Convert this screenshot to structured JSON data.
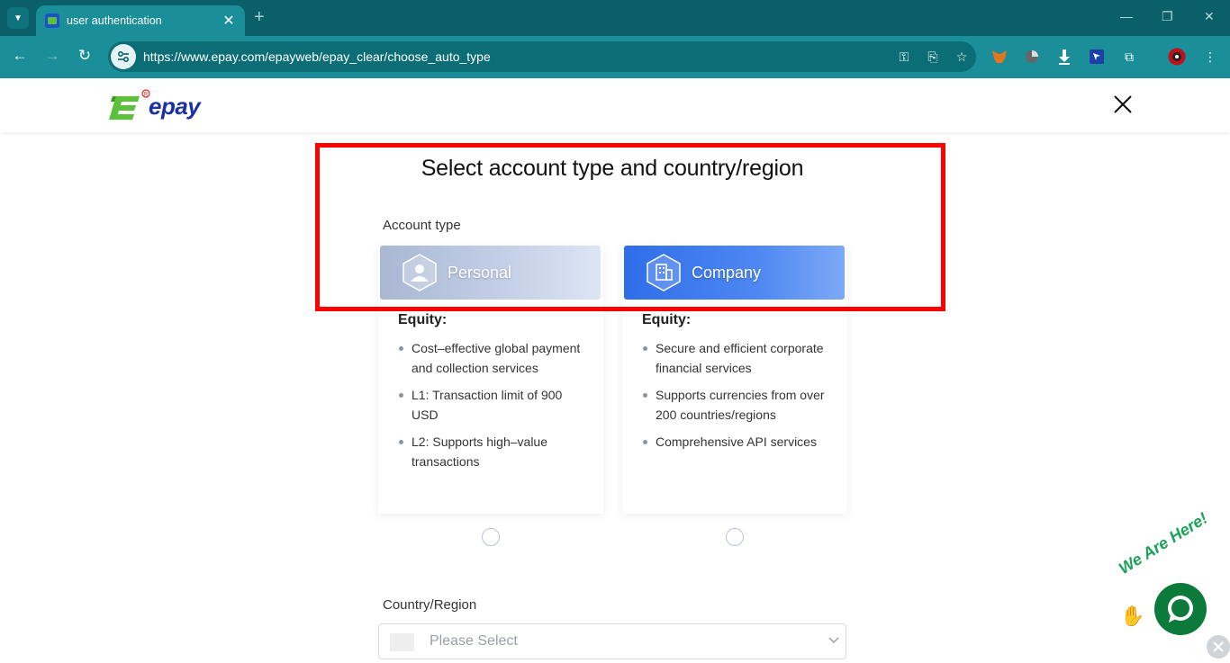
{
  "browser": {
    "tab_title": "user authentication",
    "url": "https://www.epay.com/epayweb/epay_clear/choose_auto_type"
  },
  "header": {
    "logo_text": "epay"
  },
  "main": {
    "title": "Select account type and country/region",
    "account_type_label": "Account type",
    "cards": [
      {
        "name": "Personal",
        "equity_label": "Equity:",
        "benefits": [
          "Cost–effective global payment and collection services",
          "L1: Transaction limit of 900 USD",
          "L2: Supports high–value transactions"
        ]
      },
      {
        "name": "Company",
        "equity_label": "Equity:",
        "benefits": [
          "Secure and efficient corporate financial services",
          "Supports currencies from over 200 countries/regions",
          "Comprehensive API services"
        ]
      }
    ],
    "country_label": "Country/Region",
    "country_placeholder": "Please Select"
  },
  "chat_widget": {
    "caption": "We Are Here!"
  },
  "colors": {
    "brand_blue": "#1a2fa8",
    "brand_green": "#5cc13a",
    "highlight": "#ff0000",
    "chat_green": "#0b7a3b"
  }
}
